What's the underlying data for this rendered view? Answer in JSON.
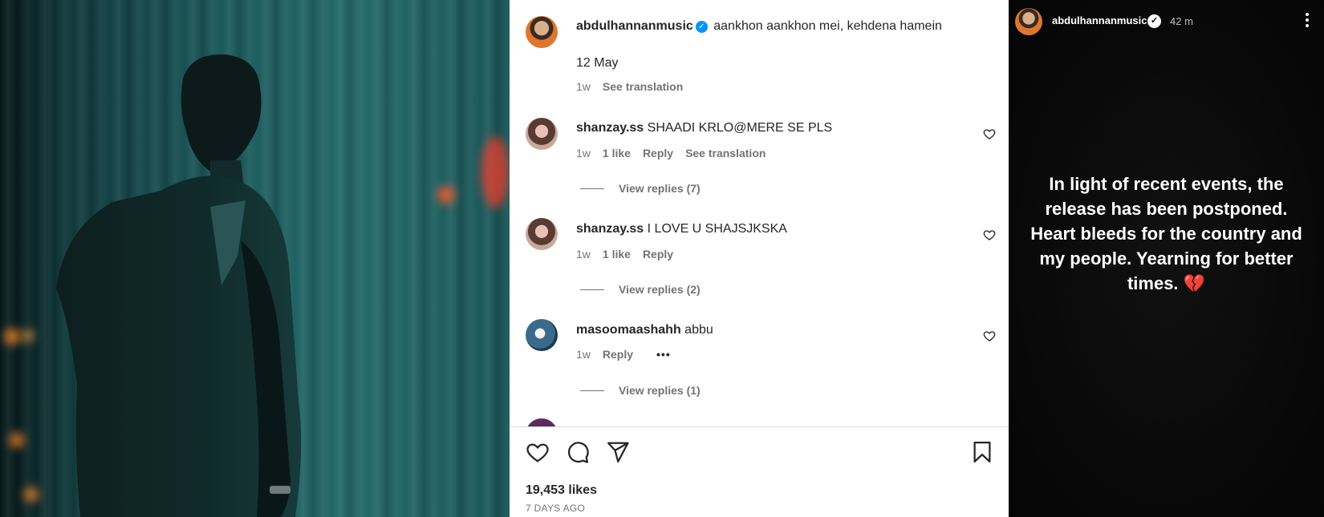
{
  "post": {
    "author": "abdulhannanmusic",
    "caption": "aankhon aankhon mei, kehdena hamein",
    "caption_line2": "12 May",
    "caption_age": "1w",
    "see_translation": "See translation",
    "comments": [
      {
        "username": "shanzay.ss",
        "text": "SHAADI KRLO@MERE SE PLS",
        "age": "1w",
        "likes": "1 like",
        "reply": "Reply",
        "translation": "See translation",
        "view_replies": "View replies (7)"
      },
      {
        "username": "shanzay.ss",
        "text": "I LOVE U SHAJSJKSKA",
        "age": "1w",
        "likes": "1 like",
        "reply": "Reply",
        "view_replies": "View replies (2)"
      },
      {
        "username": "masoomaashahh",
        "text": "abbu",
        "age": "1w",
        "reply": "Reply",
        "more": "•••",
        "view_replies": "View replies (1)"
      }
    ],
    "likes_count": "19,453 likes",
    "posted_ago": "7 DAYS AGO"
  },
  "story": {
    "username": "abdulhannanmusic",
    "time": "42 m",
    "text": "In light of recent events, the release has been postponed. Heart bleeds for the country and my people. Yearning for better times. 💔"
  },
  "icons": {
    "verified": "verified-badge-icon",
    "like": "heart-icon",
    "comment": "comment-icon",
    "share": "share-icon",
    "save": "bookmark-icon",
    "menu": "more-vertical-icon"
  },
  "colors": {
    "verified_blue": "#0095f6",
    "secondary_text": "#737373"
  }
}
